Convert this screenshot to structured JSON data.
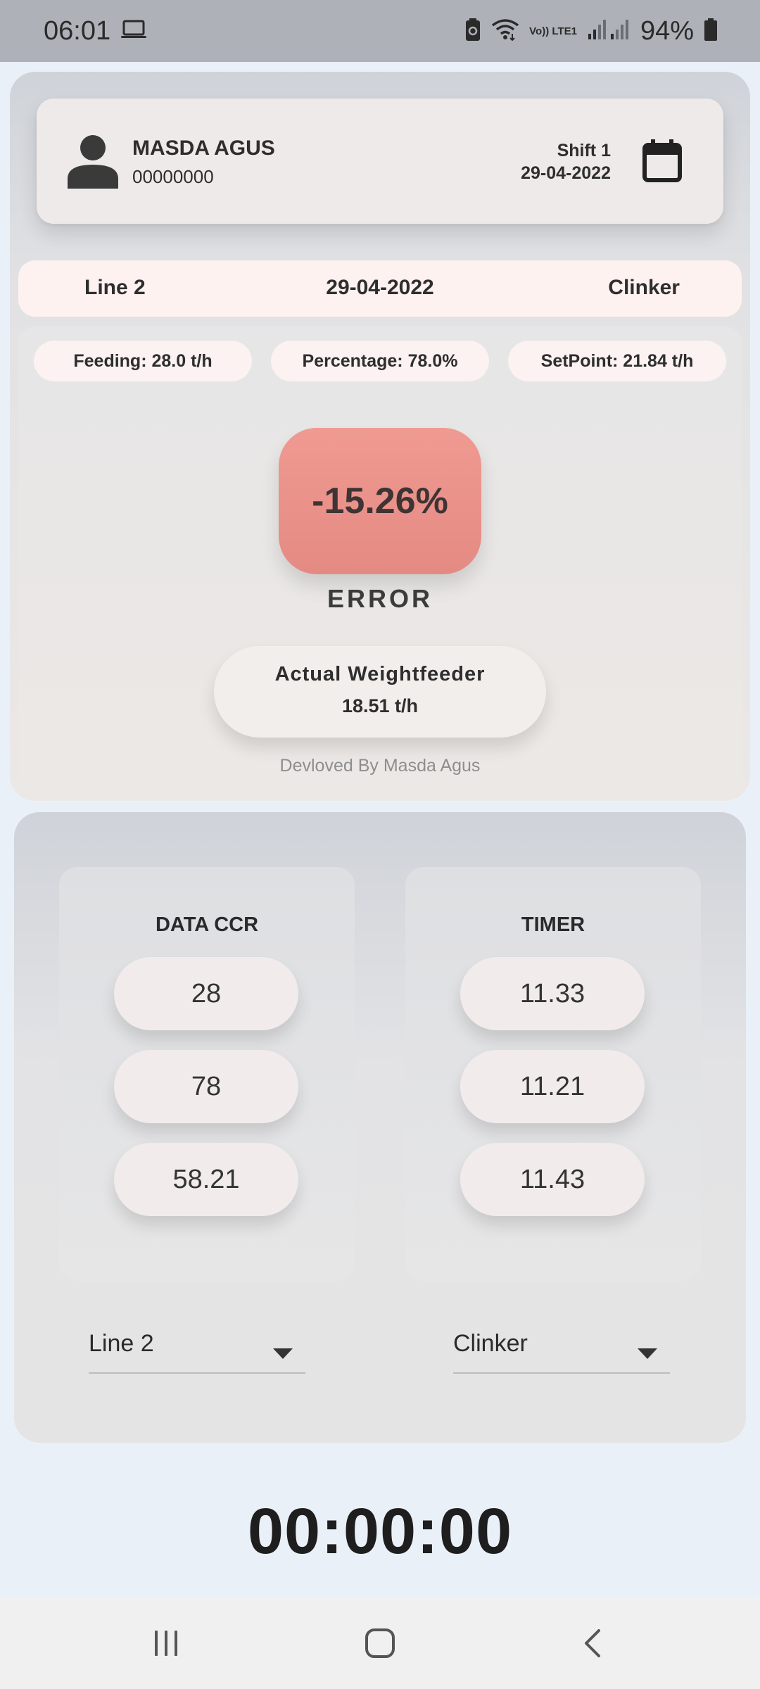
{
  "status_bar": {
    "time": "06:01",
    "network_label": "Vo)) LTE1",
    "battery": "94%",
    "icons": [
      "laptop-icon",
      "battery-saver-icon",
      "wifi-icon",
      "signal-icon",
      "battery-icon"
    ]
  },
  "user": {
    "name": "MASDA AGUS",
    "id": "00000000",
    "shift": "Shift 1",
    "date": "29-04-2022",
    "icons": [
      "person-icon",
      "calendar-icon"
    ]
  },
  "info_strip": {
    "line": "Line 2",
    "date": "29-04-2022",
    "material": "Clinker"
  },
  "stats": {
    "feeding": "Feeding: 28.0 t/h",
    "percentage": "Percentage: 78.0%",
    "setpoint": "SetPoint: 21.84 t/h",
    "error_value": "-15.26%",
    "error_label": "ERROR",
    "actual_title": "Actual Weightfeeder",
    "actual_value": "18.51 t/h",
    "credit": "Devloved By Masda Agus",
    "error_color": "#e8908a"
  },
  "data_ccr": {
    "title": "DATA CCR",
    "values": [
      "28",
      "78",
      "58.21"
    ]
  },
  "timer_col": {
    "title": "TIMER",
    "values": [
      "11.33",
      "11.21",
      "11.43"
    ]
  },
  "dropdowns": {
    "line_selected": "Line 2",
    "material_selected": "Clinker"
  },
  "stopwatch": "00:00:00",
  "nav": [
    "recent-apps-icon",
    "home-icon",
    "back-icon"
  ]
}
